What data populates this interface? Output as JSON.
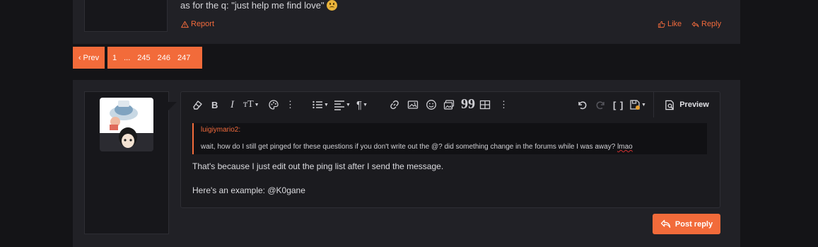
{
  "post": {
    "message_line": "as for the q: \"just help me find love\"",
    "emoji": "frowning-face",
    "report_label": "Report",
    "like_label": "Like",
    "reply_label": "Reply"
  },
  "pagination": {
    "prev_label": "‹ Prev",
    "pages": [
      "1",
      "...",
      "245",
      "246",
      "247"
    ]
  },
  "editor": {
    "preview_label": "Preview",
    "quote_author": "luigiymario2:",
    "quote_text_before": "wait, how do I still get pinged for these questions if you don't write out the @? did something change in the forums while I was away? ",
    "quote_text_flagged": "lmao",
    "body_line1": "That's because I just edit out the ping list after I send the message.",
    "body_line2": "Here's an example: @K0gane"
  },
  "submit": {
    "post_reply_label": "Post reply"
  },
  "colors": {
    "accent": "#f26b3a",
    "panel": "#212126",
    "page_bg": "#141417"
  }
}
